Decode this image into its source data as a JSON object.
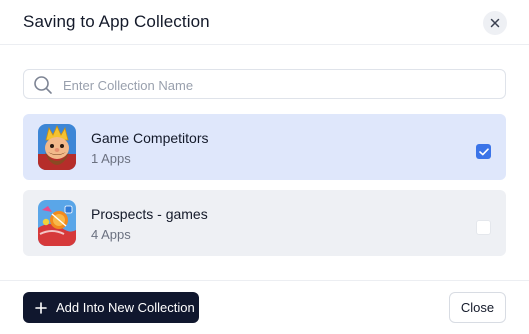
{
  "dialog": {
    "title": "Saving to App Collection",
    "close_icon": "close-icon"
  },
  "search": {
    "placeholder": "Enter Collection Name",
    "value": "",
    "icon": "search-icon"
  },
  "collections": [
    {
      "name": "Game Competitors",
      "count": "1 Apps",
      "selected": true,
      "icon": "king-character-app-icon"
    },
    {
      "name": "Prospects - games",
      "count": "4 Apps",
      "selected": false,
      "icon": "candy-app-icon"
    }
  ],
  "footer": {
    "add_label": "Add Into New Collection",
    "close_label": "Close"
  },
  "colors": {
    "selected_row": "#dfe7fb",
    "unselected_row": "#eef0f4",
    "accent": "#3b74e8",
    "primary_button": "#10172e"
  }
}
